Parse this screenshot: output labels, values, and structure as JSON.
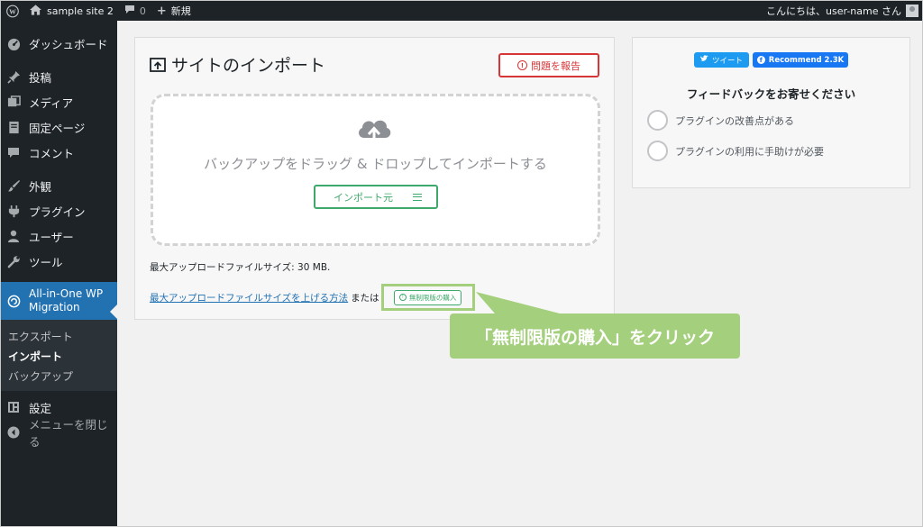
{
  "adminbar": {
    "site_name": "sample site 2",
    "comment_count": "0",
    "new_label": "新規",
    "greeting": "こんにちは、user-name さん"
  },
  "sidebar": {
    "items_top": [
      {
        "label": "ダッシュボード",
        "icon": "dashboard-icon"
      }
    ],
    "items_mid": [
      {
        "label": "投稿",
        "icon": "pin-icon"
      },
      {
        "label": "メディア",
        "icon": "media-icon"
      },
      {
        "label": "固定ページ",
        "icon": "page-icon"
      },
      {
        "label": "コメント",
        "icon": "comment-icon"
      }
    ],
    "items_low": [
      {
        "label": "外観",
        "icon": "brush-icon"
      },
      {
        "label": "プラグイン",
        "icon": "plugin-icon"
      },
      {
        "label": "ユーザー",
        "icon": "user-icon"
      },
      {
        "label": "ツール",
        "icon": "wrench-icon"
      }
    ],
    "current": {
      "label_line1": "All-in-One WP",
      "label_line2": "Migration",
      "icon": "migration-icon"
    },
    "submenu": [
      {
        "label": "エクスポート",
        "active": false
      },
      {
        "label": "インポート",
        "active": true
      },
      {
        "label": "バックアップ",
        "active": false
      }
    ],
    "items_bottom": [
      {
        "label": "設定",
        "icon": "settings-icon"
      },
      {
        "label": "メニューを閉じる",
        "icon": "collapse-icon"
      }
    ]
  },
  "import_panel": {
    "title": "サイトのインポート",
    "report_button": "問題を報告",
    "drop_text": "バックアップをドラッグ & ドロップしてインポートする",
    "import_button": "インポート元",
    "max_size": "最大アップロードファイルサイズ: 30 MB.",
    "raise_limit_link": "最大アップロードファイルサイズを上げる方法",
    "or_text": "または",
    "unlimited_button": "無制限版の購入"
  },
  "callout": {
    "text": "「無制限版の購入」をクリック",
    "color": "#a4cf7d"
  },
  "feedback_panel": {
    "tweet_button": "ツイート",
    "recommend_button": "Recommend 2.3K",
    "title": "フィードバックをお寄せください",
    "options": [
      "プラグインの改善点がある",
      "プラグインの利用に手助けが必要"
    ]
  },
  "colors": {
    "admin_dark": "#1d2327",
    "wp_blue": "#2271b1",
    "red": "#d63638",
    "green": "#3fa96b"
  }
}
